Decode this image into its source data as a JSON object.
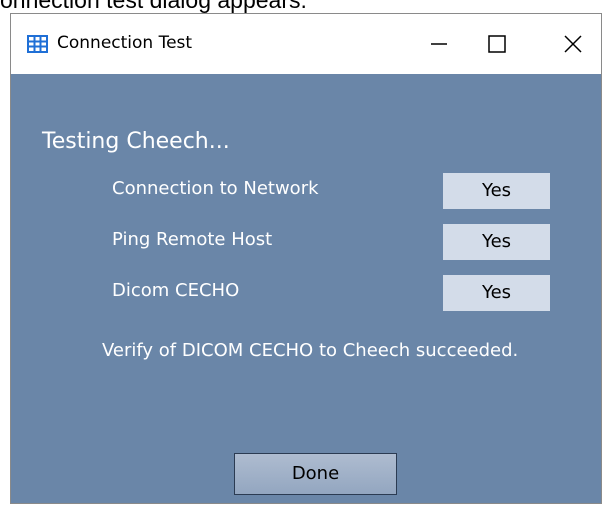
{
  "caption": "onnection test dialog appears.",
  "window": {
    "title": "Connection Test",
    "icon": "grid-app-icon",
    "controls": [
      "minimize-icon",
      "maximize-icon",
      "close-icon"
    ]
  },
  "dialog": {
    "heading": "Testing Cheech...",
    "rows": [
      {
        "label": "Connection to Network",
        "value": "Yes"
      },
      {
        "label": "Ping Remote Host",
        "value": "Yes"
      },
      {
        "label": "Dicom CECHO",
        "value": "Yes"
      }
    ],
    "message": "Verify of DICOM CECHO to Cheech succeeded.",
    "done_label": "Done"
  },
  "colors": {
    "client_background": "#6a86a8",
    "value_box": "#d3dce9",
    "button": "#9fb0c8",
    "icon_blue": "#1f6fd6"
  }
}
